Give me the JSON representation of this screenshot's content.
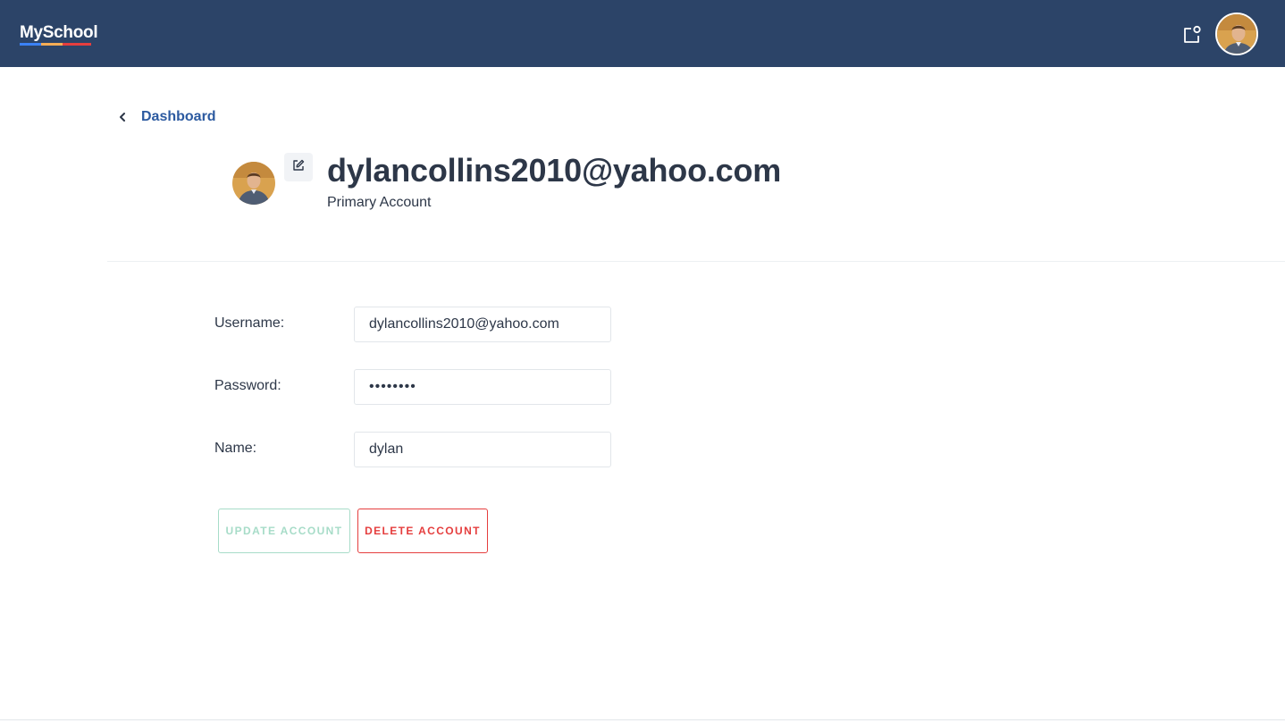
{
  "header": {
    "logo_text": "MySchool",
    "icons": {
      "notifications": "notification-icon",
      "avatar": "user-avatar"
    },
    "colors": {
      "bar": "#2c4468"
    }
  },
  "back_link": {
    "label": "Dashboard",
    "icon": "chevron-left-icon"
  },
  "profile": {
    "title": "dylancollins2010@yahoo.com",
    "subtitle": "Primary Account",
    "edit_icon": "edit-icon"
  },
  "form": {
    "username": {
      "label": "Username:",
      "value": "dylancollins2010@yahoo.com"
    },
    "password": {
      "label": "Password:",
      "value": "••••••••"
    },
    "name": {
      "label": "Name:",
      "value": "dylan"
    }
  },
  "actions": {
    "update_label": "UPDATE ACCOUNT",
    "delete_label": "DELETE ACCOUNT",
    "colors": {
      "update": "#a7dcc8",
      "delete": "#e53e3e"
    }
  }
}
